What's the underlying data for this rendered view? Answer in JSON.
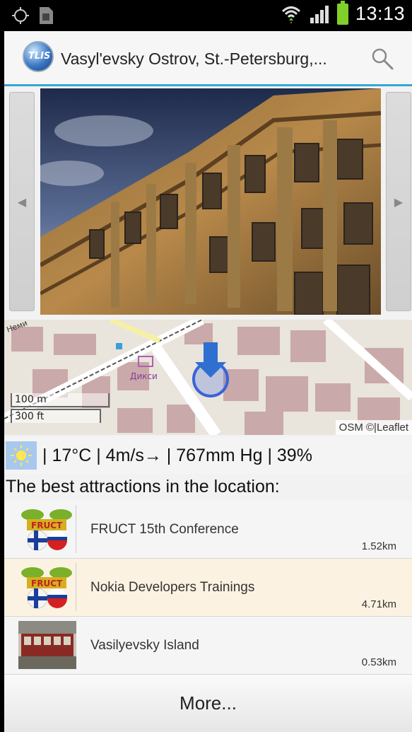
{
  "status_bar": {
    "time": "13:13",
    "icons": [
      "gps-icon",
      "sim-card-icon",
      "wifi-icon",
      "signal-icon",
      "battery-icon"
    ]
  },
  "action_bar": {
    "title": "Vasyl'evsky Ostrov, St.-Petersburg,...",
    "logo_text": "TLIS",
    "icons": [
      "app-logo-icon",
      "search-icon"
    ],
    "accent_color": "#33a8d8"
  },
  "gallery": {
    "prev_icon": "◀",
    "next_icon": "▶"
  },
  "map": {
    "scale_metric": "100 m",
    "scale_imperial": "300 ft",
    "attribution": "OSM ©|Leaflet",
    "street_label": "Неми",
    "shop_label": "Дикси"
  },
  "weather": {
    "icon": "sun-icon",
    "text": "| 17°C | 4m/s→ | 767mm Hg | 39%"
  },
  "attractions": {
    "heading": "The best attractions in the location:",
    "items": [
      {
        "title": "FRUCT 15th Conference",
        "distance": "1.52km",
        "thumb": "fruct-logo-icon"
      },
      {
        "title": "Nokia Developers Trainings",
        "distance": "4.71km",
        "thumb": "fruct-logo-icon"
      },
      {
        "title": "Vasilyevsky Island",
        "distance": "0.53km",
        "thumb": "tram-photo"
      }
    ],
    "more_label": "More..."
  }
}
